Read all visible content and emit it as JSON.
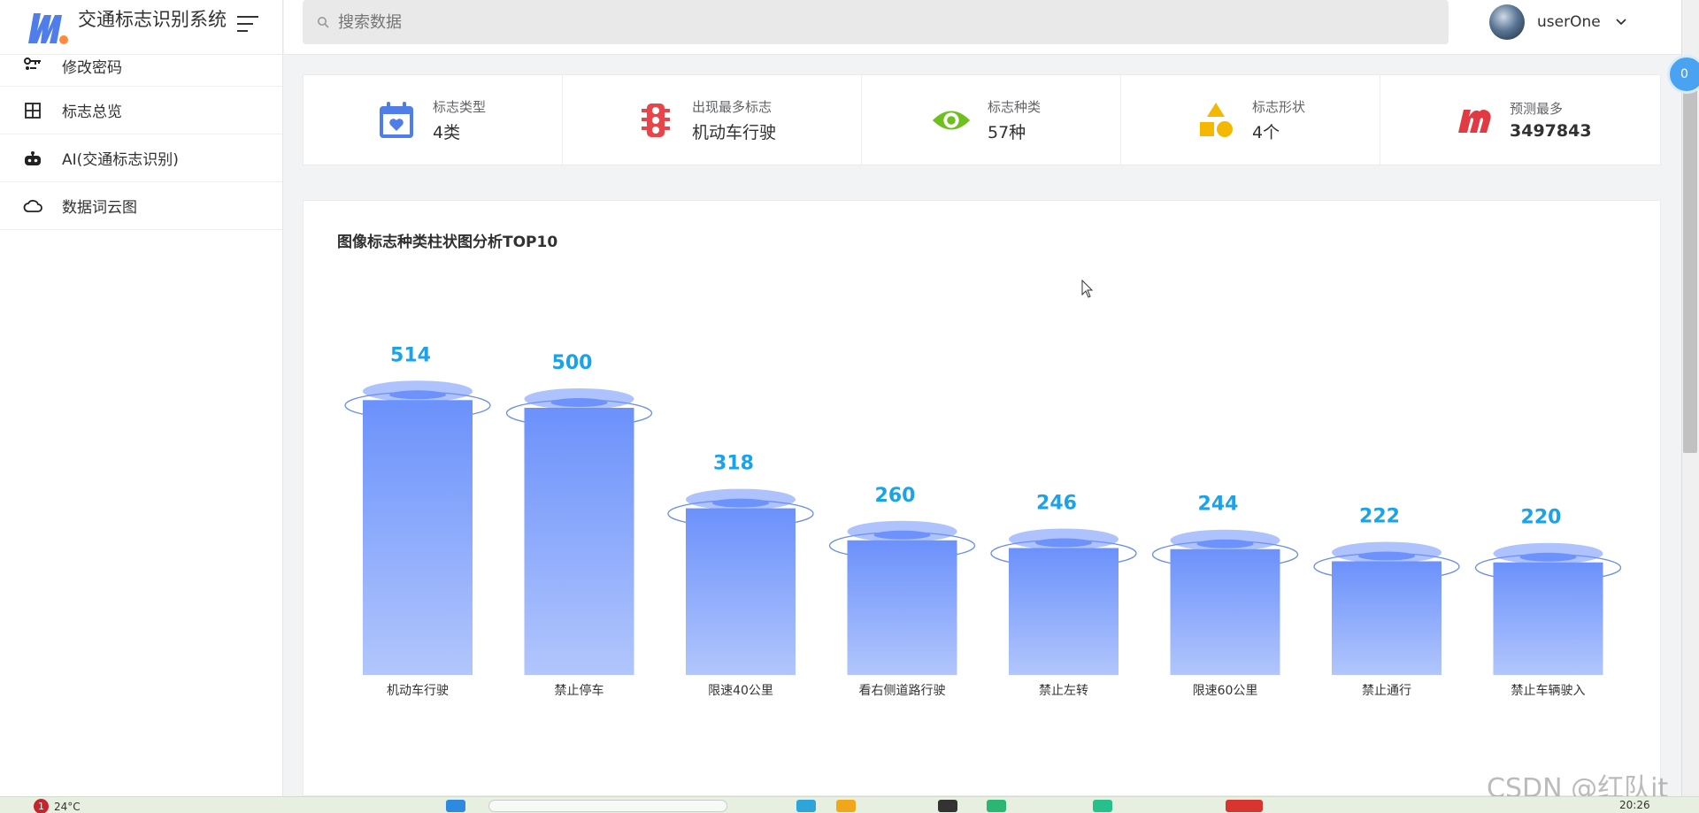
{
  "brand": {
    "title": "交通标志识别系统"
  },
  "sidebar": {
    "items": [
      {
        "label": "修改密码",
        "icon": "key-icon"
      },
      {
        "label": "标志总览",
        "icon": "grid-icon"
      },
      {
        "label": "AI(交通标志识别)",
        "icon": "robot-icon"
      },
      {
        "label": "数据词云图",
        "icon": "cloud-icon"
      }
    ]
  },
  "header": {
    "search_placeholder": "搜索数据",
    "username": "userOne"
  },
  "stats": [
    {
      "label": "标志类型",
      "value": "4类",
      "icon": "calendar-heart-icon",
      "color": "#4f7de9"
    },
    {
      "label": "出现最多标志",
      "value": "机动车行驶",
      "icon": "traffic-light-icon",
      "color": "#e8444a"
    },
    {
      "label": "标志种类",
      "value": "57种",
      "icon": "eye-icon",
      "color": "#6fbf1e"
    },
    {
      "label": "标志形状",
      "value": "4个",
      "icon": "shapes-icon",
      "color": "#f5b800"
    },
    {
      "label": "预测最多",
      "value": "3497843",
      "icon": "m-logo-icon",
      "color": "#e23a43"
    }
  ],
  "chart_title": "图像标志种类柱状图分析TOP10",
  "chart_data": {
    "type": "bar",
    "title": "图像标志种类柱状图分析TOP10",
    "categories": [
      "机动车行驶",
      "禁止停车",
      "限速40公里",
      "看右侧道路行驶",
      "禁止左转",
      "限速60公里",
      "禁止通行",
      "禁止车辆驶入"
    ],
    "values": [
      514,
      500,
      318,
      260,
      246,
      244,
      222,
      220
    ],
    "label_color": "#1aa3e8",
    "bar_color_top": "#6b91fb",
    "bar_color_bottom": "#b2c6fc",
    "grid": false,
    "ylim": [
      0,
      560
    ]
  },
  "floating_badge": "0",
  "taskbar": {
    "weather": "24°C",
    "notification_count": "1",
    "time": "20:26"
  },
  "watermark": "CSDN @红队it"
}
